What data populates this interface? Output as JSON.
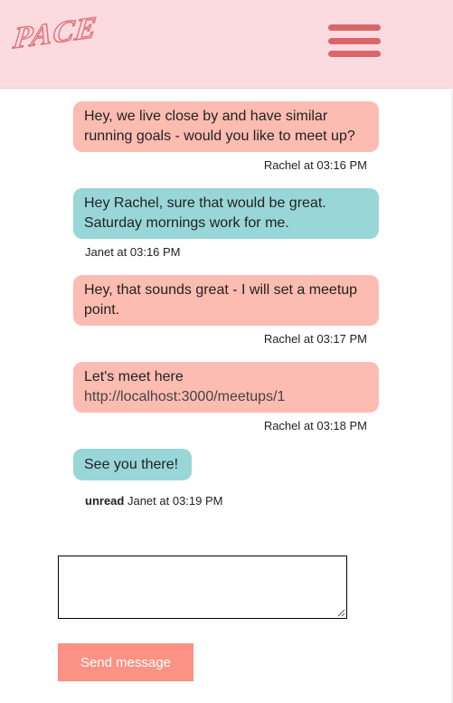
{
  "header": {
    "logo_text": "PACE",
    "menu_icon": "hamburger-menu-icon",
    "background": "#fcdbe0",
    "accent": "#d9666b"
  },
  "colors": {
    "rachel_bubble": "#fcbcb1",
    "janet_bubble": "#98d6d8",
    "send_button": "#fb9283"
  },
  "messages": [
    {
      "sender": "Rachel",
      "text": "Hey, we live close by and have similar running goals - would you like to meet up?",
      "meta": "Rachel at 03:16 PM"
    },
    {
      "sender": "Janet",
      "text": "Hey Rachel, sure that would be great. Saturday mornings work for me.",
      "meta": "Janet at 03:16 PM"
    },
    {
      "sender": "Rachel",
      "text": "Hey, that sounds great - I will set a meetup point.",
      "meta": "Rachel at 03:17 PM"
    },
    {
      "sender": "Rachel",
      "text": "Let's meet here",
      "link": "http://localhost:3000/meetups/1",
      "meta": "Rachel at 03:18 PM"
    },
    {
      "sender": "Janet",
      "text": "See you there!",
      "status": "unread",
      "meta": "Janet at 03:19 PM"
    }
  ],
  "compose": {
    "value": "",
    "send_label": "Send message"
  }
}
